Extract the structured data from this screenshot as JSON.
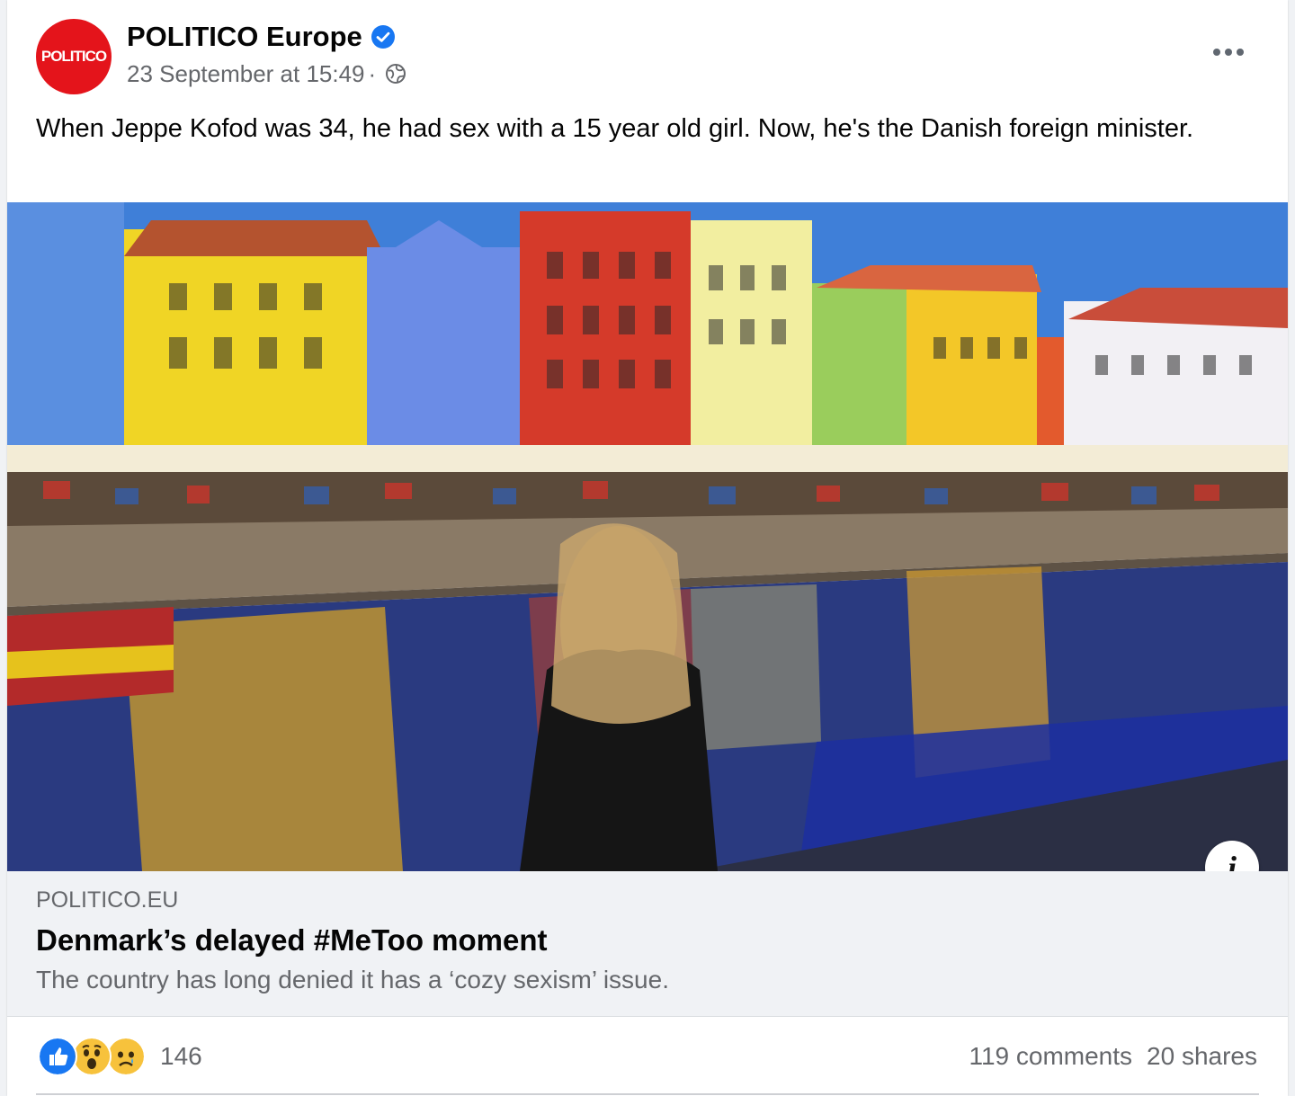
{
  "post": {
    "author": {
      "name": "POLITICO Europe",
      "avatar_text": "POLITICO",
      "verified_icon": "verified-badge-icon",
      "avatar_color": "#e4141b",
      "verified_color": "#1877f2"
    },
    "timestamp": "23 September at 15:49",
    "separator": "·",
    "audience_icon": "globe-icon",
    "more_icon": "more-horizontal-icon",
    "text": "When Jeppe Kofod was 34, he had sex with a 15 year old girl. Now, he's the Danish foreign minister."
  },
  "link": {
    "domain": "POLITICO.EU",
    "title": "Denmark’s delayed #MeToo moment",
    "description": "The country has long denied it has a ‘cozy sexism’ issue.",
    "image_icon": "info-icon"
  },
  "footer": {
    "reaction_icons": [
      "like-icon",
      "wow-icon",
      "sad-icon"
    ],
    "reaction_count": "146",
    "comments": "119 comments",
    "shares": "20 shares"
  }
}
